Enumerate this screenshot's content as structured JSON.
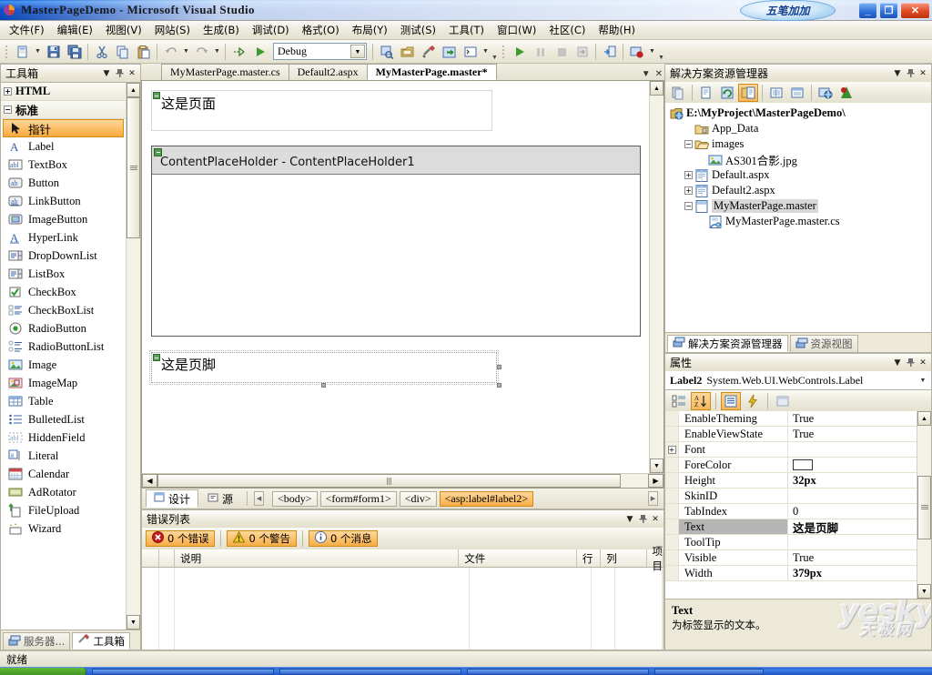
{
  "window": {
    "title": "MasterPageDemo - Microsoft Visual Studio",
    "ime_badge": "五笔加加",
    "minimize": "_",
    "maximize": "❐",
    "close": "✕"
  },
  "menubar": {
    "items": [
      {
        "label": "文件(F)"
      },
      {
        "label": "编辑(E)"
      },
      {
        "label": "视图(V)"
      },
      {
        "label": "网站(S)"
      },
      {
        "label": "生成(B)"
      },
      {
        "label": "调试(D)"
      },
      {
        "label": "格式(O)"
      },
      {
        "label": "布局(Y)"
      },
      {
        "label": "测试(S)"
      },
      {
        "label": "工具(T)"
      },
      {
        "label": "窗口(W)"
      },
      {
        "label": "社区(C)"
      },
      {
        "label": "帮助(H)"
      }
    ]
  },
  "toolbar": {
    "config_value": "Debug",
    "buttons": [
      {
        "name": "new-item-icon"
      },
      {
        "name": "save-icon"
      },
      {
        "name": "save-all-icon"
      },
      {
        "name": "cut-icon"
      },
      {
        "name": "copy-icon"
      },
      {
        "name": "paste-icon"
      },
      {
        "name": "undo-icon"
      },
      {
        "name": "redo-icon"
      },
      {
        "name": "navigate-forward-icon"
      },
      {
        "name": "start-debug-icon"
      }
    ]
  },
  "toolbox": {
    "title": "工具箱",
    "categories": [
      {
        "label": "HTML",
        "expanded": false
      },
      {
        "label": "标准",
        "expanded": true
      }
    ],
    "items": [
      {
        "label": "指针",
        "icon": "pointer-icon",
        "selected": true
      },
      {
        "label": "Label",
        "icon": "label-icon",
        "selected": false
      },
      {
        "label": "TextBox",
        "icon": "textbox-icon",
        "selected": false
      },
      {
        "label": "Button",
        "icon": "button-icon",
        "selected": false
      },
      {
        "label": "LinkButton",
        "icon": "linkbutton-icon",
        "selected": false
      },
      {
        "label": "ImageButton",
        "icon": "imagebutton-icon",
        "selected": false
      },
      {
        "label": "HyperLink",
        "icon": "hyperlink-icon",
        "selected": false
      },
      {
        "label": "DropDownList",
        "icon": "dropdownlist-icon",
        "selected": false
      },
      {
        "label": "ListBox",
        "icon": "listbox-icon",
        "selected": false
      },
      {
        "label": "CheckBox",
        "icon": "checkbox-icon",
        "selected": false
      },
      {
        "label": "CheckBoxList",
        "icon": "checkboxlist-icon",
        "selected": false
      },
      {
        "label": "RadioButton",
        "icon": "radiobutton-icon",
        "selected": false
      },
      {
        "label": "RadioButtonList",
        "icon": "radiobuttonlist-icon",
        "selected": false
      },
      {
        "label": "Image",
        "icon": "image-icon",
        "selected": false
      },
      {
        "label": "ImageMap",
        "icon": "imagemap-icon",
        "selected": false
      },
      {
        "label": "Table",
        "icon": "table-icon",
        "selected": false
      },
      {
        "label": "BulletedList",
        "icon": "bulletedlist-icon",
        "selected": false
      },
      {
        "label": "HiddenField",
        "icon": "hiddenfield-icon",
        "selected": false
      },
      {
        "label": "Literal",
        "icon": "literal-icon",
        "selected": false
      },
      {
        "label": "Calendar",
        "icon": "calendar-icon",
        "selected": false
      },
      {
        "label": "AdRotator",
        "icon": "adrotator-icon",
        "selected": false
      },
      {
        "label": "FileUpload",
        "icon": "fileupload-icon",
        "selected": false
      },
      {
        "label": "Wizard",
        "icon": "wizard-icon",
        "selected": false
      }
    ],
    "dock_tabs": [
      {
        "label": "服务器...",
        "icon": "server-explorer-icon",
        "active": false
      },
      {
        "label": "工具箱",
        "icon": "toolbox-icon",
        "active": true
      }
    ]
  },
  "document_tabs": [
    {
      "label": "MyMasterPage.master.cs",
      "active": false
    },
    {
      "label": "Default2.aspx",
      "active": false
    },
    {
      "label": "MyMasterPage.master*",
      "active": true
    }
  ],
  "designer": {
    "header_label_text": "这是页面",
    "content_placeholder_title": "ContentPlaceHolder - ContentPlaceHolder1",
    "footer_label_text": "这是页脚"
  },
  "viewbar": {
    "design_label": "设计",
    "source_label": "源",
    "tags": [
      {
        "label": "<body>",
        "active": false
      },
      {
        "label": "<form#form1>",
        "active": false
      },
      {
        "label": "<div>",
        "active": false
      },
      {
        "label": "<asp:label#label2>",
        "active": true
      }
    ]
  },
  "error_list": {
    "title": "错误列表",
    "buttons": [
      {
        "label": "0 个错误",
        "icon": "error-icon"
      },
      {
        "label": "0 个警告",
        "icon": "warning-icon"
      },
      {
        "label": "0 个消息",
        "icon": "info-icon"
      }
    ],
    "columns": [
      "",
      "",
      "说明",
      "文件",
      "行",
      "列",
      "项目"
    ],
    "rows": []
  },
  "solution_explorer": {
    "title": "解决方案资源管理器",
    "tree": [
      {
        "label": "E:\\MyProject\\MasterPageDemo\\",
        "indent": 0,
        "expander": "",
        "icon": "solution-icon",
        "selected": false,
        "root": true
      },
      {
        "label": "App_Data",
        "indent": 1,
        "expander": "",
        "icon": "folder-icon",
        "selected": false
      },
      {
        "label": "images",
        "indent": 1,
        "expander": "-",
        "icon": "folder-open-icon",
        "selected": false
      },
      {
        "label": "AS301合影.jpg",
        "indent": 2,
        "expander": "",
        "icon": "image-file-icon",
        "selected": false
      },
      {
        "label": "Default.aspx",
        "indent": 1,
        "expander": "+",
        "icon": "aspx-file-icon",
        "selected": false
      },
      {
        "label": "Default2.aspx",
        "indent": 1,
        "expander": "+",
        "icon": "aspx-file-icon",
        "selected": false
      },
      {
        "label": "MyMasterPage.master",
        "indent": 1,
        "expander": "-",
        "icon": "master-file-icon",
        "selected": true
      },
      {
        "label": "MyMasterPage.master.cs",
        "indent": 2,
        "expander": "",
        "icon": "cs-file-icon",
        "selected": false
      }
    ],
    "dock_tabs": [
      {
        "label": "解决方案资源管理器",
        "active": true
      },
      {
        "label": "资源视图",
        "active": false
      }
    ]
  },
  "properties": {
    "title": "属性",
    "object_name": "Label2",
    "object_type": "System.Web.UI.WebControls.Label",
    "rows": [
      {
        "name": "EnableTheming",
        "value": "True",
        "expander": "",
        "bold": false,
        "selected": false,
        "swatch": false
      },
      {
        "name": "EnableViewState",
        "value": "True",
        "expander": "",
        "bold": false,
        "selected": false,
        "swatch": false
      },
      {
        "name": "Font",
        "value": "",
        "expander": "+",
        "bold": false,
        "selected": false,
        "swatch": false
      },
      {
        "name": "ForeColor",
        "value": "",
        "expander": "",
        "bold": false,
        "selected": false,
        "swatch": true
      },
      {
        "name": "Height",
        "value": "32px",
        "expander": "",
        "bold": true,
        "selected": false,
        "swatch": false
      },
      {
        "name": "SkinID",
        "value": "",
        "expander": "",
        "bold": false,
        "selected": false,
        "swatch": false
      },
      {
        "name": "TabIndex",
        "value": "0",
        "expander": "",
        "bold": false,
        "selected": false,
        "swatch": false
      },
      {
        "name": "Text",
        "value": "这是页脚",
        "expander": "",
        "bold": true,
        "selected": true,
        "swatch": false
      },
      {
        "name": "ToolTip",
        "value": "",
        "expander": "",
        "bold": false,
        "selected": false,
        "swatch": false
      },
      {
        "name": "Visible",
        "value": "True",
        "expander": "",
        "bold": false,
        "selected": false,
        "swatch": false
      },
      {
        "name": "Width",
        "value": "379px",
        "expander": "",
        "bold": true,
        "selected": false,
        "swatch": false
      }
    ],
    "description_title": "Text",
    "description_body": "为标签显示的文本。",
    "watermark_main": "yesky",
    "watermark_sub": "天极网"
  },
  "statusbar": {
    "text": "就绪"
  }
}
